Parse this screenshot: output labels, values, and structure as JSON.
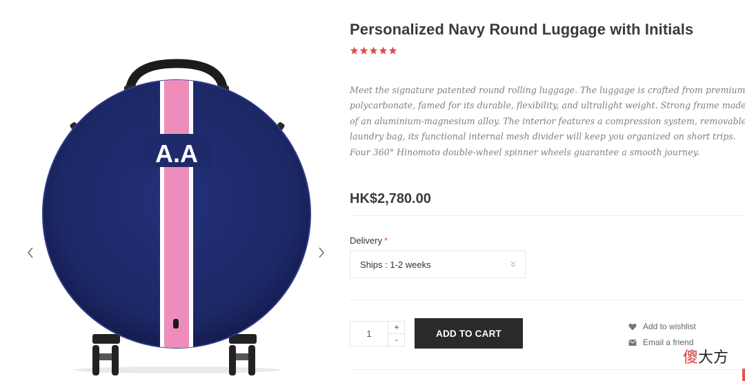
{
  "product": {
    "title": "Personalized Navy Round Luggage with Initials",
    "rating": 5,
    "rating_color": "#d9534f",
    "initials": "A.A",
    "description": "Meet the signature patented round rolling luggage. The luggage is crafted from premium polycarbonate, famed for its durable, flexibility, and ultralight weight. Strong frame made of an aluminium-magnesium alloy. The interior features a compression system, removable laundry bag, its functional internal mesh divider will keep you organized on short trips. Four 360° Hinomoto double-wheel spinner wheels guarantee a smooth journey.",
    "price": "HK$2,780.00"
  },
  "options": {
    "delivery_label": "Delivery",
    "required_mark": "*",
    "delivery_selected": "Ships : 1-2 weeks"
  },
  "cart": {
    "quantity": "1",
    "plus": "+",
    "minus": "-",
    "add_to_cart_label": "ADD TO CART"
  },
  "links": {
    "wishlist": "Add to wishlist",
    "email": "Email a friend"
  },
  "gallery": {
    "prev_icon": "chevron-left-icon",
    "next_icon": "chevron-right-icon"
  },
  "watermark": {
    "first": "傻",
    "rest": "大方"
  },
  "colors": {
    "navy": "#1f2a6b",
    "stripe_pink": "#ee8dbb",
    "button": "#2a2a2a"
  }
}
